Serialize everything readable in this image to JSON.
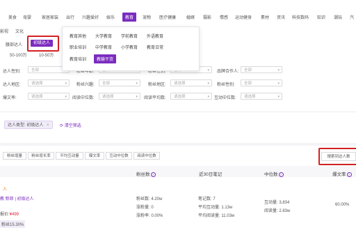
{
  "colors": {
    "accent": "#7b2cbf",
    "highlight_border": "#d32020"
  },
  "nav": {
    "items": [
      "美食",
      "母婴",
      "家居家装",
      "出行",
      "兴趣爱好",
      "娱乐",
      "教育",
      "宠物",
      "医疗健康",
      "婚嫁",
      "摄影",
      "情感",
      "运动健身",
      "素材",
      "资讯",
      "科技数码",
      "知识",
      "潮玩",
      "汽"
    ],
    "active_index": 6,
    "row2": [
      "影视",
      "文化"
    ]
  },
  "level_filter": {
    "items": [
      "腰部达人",
      "初级达人"
    ],
    "active_index": 1,
    "fans": [
      "50-100万",
      "10-50万"
    ]
  },
  "dropdown": {
    "rows": [
      [
        "教育其他",
        "大学教育",
        "学前教育",
        "外语教育"
      ],
      [
        "职业培训",
        "中学教育",
        "小学教育",
        "教育日常"
      ],
      [
        "教育培训",
        "教输干货"
      ]
    ],
    "active": "教输干货"
  },
  "filters": {
    "row1": [
      {
        "label": "达人性别:",
        "value": "全部"
      },
      {
        "label": "粉丝年龄:",
        "value": "全部"
      },
      {
        "label": "粉丝性别:",
        "value": "全部"
      },
      {
        "label": "品牌合作人:",
        "value": "全部"
      }
    ],
    "row2": [
      {
        "label": "达人地区:",
        "value": "请选择"
      },
      {
        "label": "粉丝兴趣:",
        "value": "全部"
      },
      {
        "label": "粉丝地区:",
        "value": "请选择"
      },
      {
        "label": "粉丝性别:",
        "value": "全部"
      }
    ],
    "row3": [
      {
        "label": "爆文率:",
        "value": "请选择"
      },
      {
        "label": "阅读中位数:",
        "value": "请选择"
      },
      {
        "label": "阅读平均数:",
        "value": "请选择"
      },
      {
        "label": "互动中位数:",
        "value": "请选择"
      }
    ]
  },
  "selected": {
    "chip": "达人类型: 初级达人",
    "clear": "清空筛选"
  },
  "sort_buttons": [
    "粉丝增量",
    "粉丝增长率",
    "平均互动量",
    "爆文率",
    "互动中位数",
    "阅读中位数"
  ],
  "search_button": "搜索到达人数",
  "table": {
    "headers": [
      "粉丝数",
      "近30日笔记",
      "中位数",
      "爆文率"
    ],
    "row": {
      "tag": "入",
      "subtitle": "教 新郎 | 初级达人",
      "quote_label": "报价:",
      "quote_value": "¥499",
      "ratio": "粉丝15.30%",
      "fans": "粉丝数: 4.20w",
      "fans_growth": "涨粉量: 0",
      "fans_rate": "涨粉率: 0.00%",
      "notes": "笔记数: 7",
      "avg_interaction": "平均互动量: 1.13w",
      "avg_read": "平均阅读量: 11.03w",
      "interact_median": "互动量: 3,834",
      "read_median": "阅读量: 2.83w",
      "viral_rate": "60.00%"
    }
  }
}
